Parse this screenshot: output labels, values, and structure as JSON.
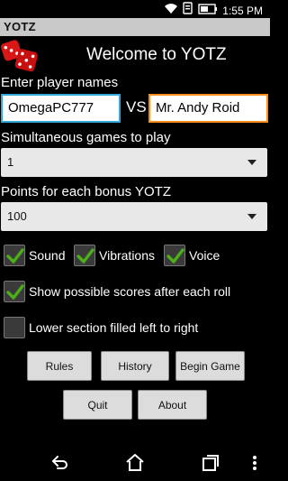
{
  "status_bar": {
    "time": "1:55 PM",
    "icons": [
      "wifi-icon",
      "notification-icon",
      "battery-icon"
    ]
  },
  "app": {
    "title": "YOTZ",
    "welcome": "Welcome to YOTZ",
    "logo_icon": "dice-icon"
  },
  "players": {
    "label": "Enter player names",
    "player1": "OmegaPC777",
    "vs": "VS",
    "player2": "Mr. Andy Roid"
  },
  "games": {
    "label": "Simultaneous games to play",
    "value": "1"
  },
  "bonus": {
    "label": "Points for each bonus YOTZ",
    "value": "100"
  },
  "options": {
    "sound": {
      "label": "Sound",
      "checked": true
    },
    "vibrations": {
      "label": "Vibrations",
      "checked": true
    },
    "voice": {
      "label": "Voice",
      "checked": true
    },
    "show_scores": {
      "label": "Show possible scores after each roll",
      "checked": true
    },
    "lower_section": {
      "label": "Lower section filled left to right",
      "checked": false
    }
  },
  "buttons": {
    "rules": "Rules",
    "history": "History",
    "begin_game": "Begin Game",
    "quit": "Quit",
    "about": "About"
  },
  "colors": {
    "check": "#4caf1a",
    "focus_left": "#35a8d8",
    "focus_right": "#ff8c1a",
    "title_bar": "#c8c8c8",
    "dice": "#d81818"
  },
  "navbar": {
    "icons": [
      "back-icon",
      "home-icon",
      "recents-icon",
      "menu-icon"
    ]
  }
}
